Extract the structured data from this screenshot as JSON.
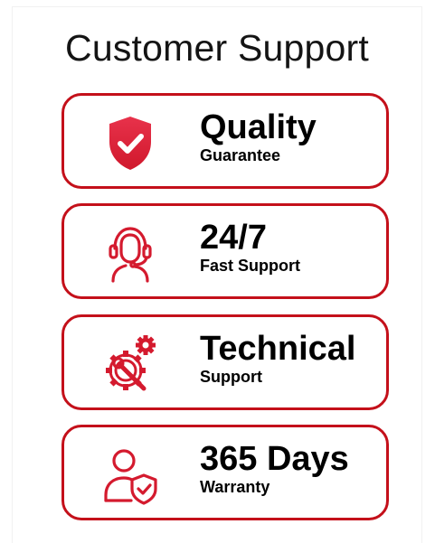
{
  "title": "Customer Support",
  "accent_color": "#c4101a",
  "features": [
    {
      "headline": "Quality",
      "sub": "Guarantee",
      "icon": "shield-check-icon"
    },
    {
      "headline": "24/7",
      "sub": "Fast Support",
      "icon": "headset-agent-icon"
    },
    {
      "headline": "Technical",
      "sub": "Support",
      "icon": "gear-wrench-icon"
    },
    {
      "headline": "365 Days",
      "sub": "Warranty",
      "icon": "user-shield-icon"
    }
  ]
}
